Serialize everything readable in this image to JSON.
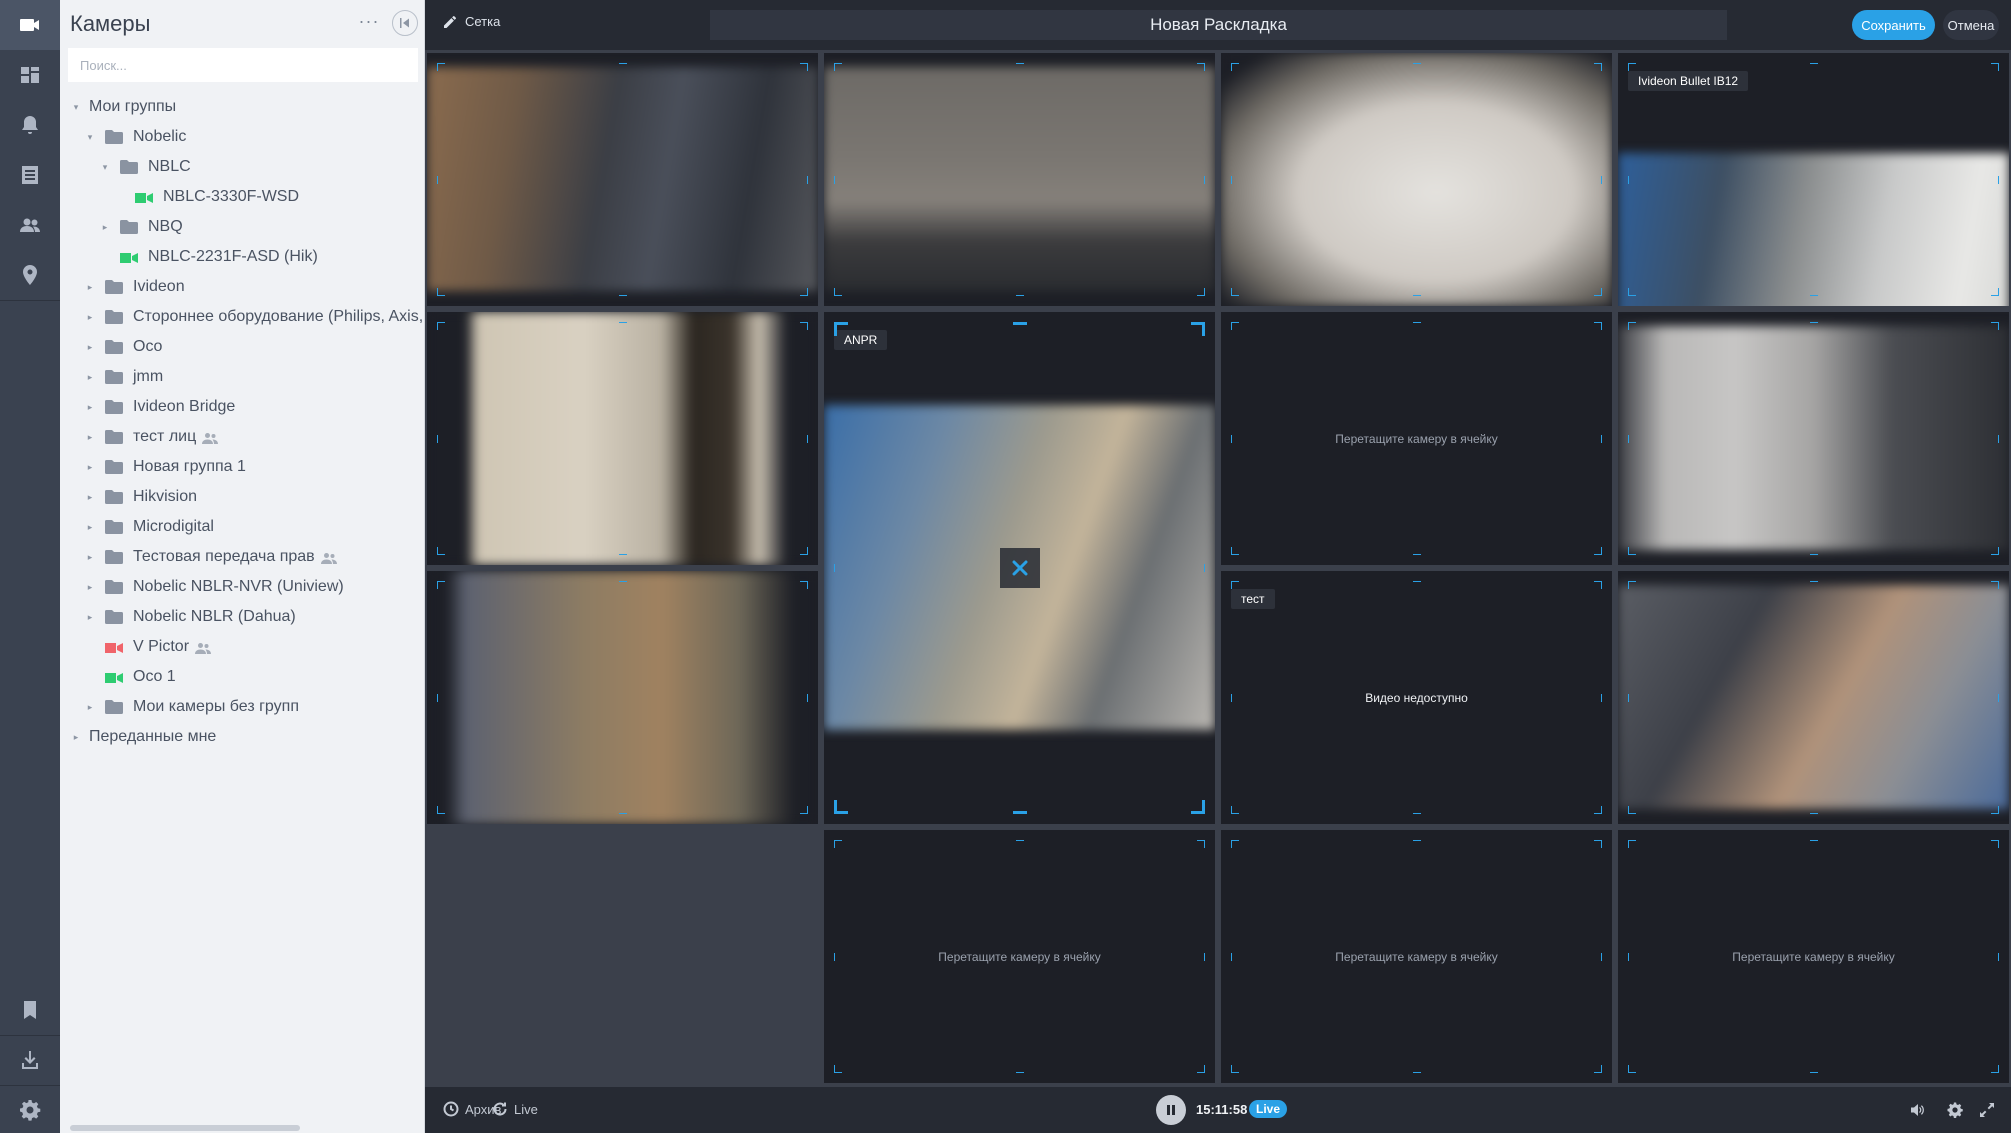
{
  "sidebar": {
    "title": "Камеры",
    "more": "···",
    "search_placeholder": "Поиск...",
    "tree": [
      {
        "label": "Мои группы",
        "level": 0,
        "arrow": "▾",
        "type": "text"
      },
      {
        "label": "Nobelic",
        "level": 1,
        "arrow": "▾",
        "type": "folder"
      },
      {
        "label": "NBLC",
        "level": 2,
        "arrow": "▾",
        "type": "folder"
      },
      {
        "label": "NBLC-3330F-WSD",
        "level": 3,
        "arrow": "",
        "type": "camera",
        "status": "online"
      },
      {
        "label": "NBQ",
        "level": 2,
        "arrow": "▸",
        "type": "folder"
      },
      {
        "label": "NBLC-2231F-ASD (Hik)",
        "level": 2,
        "arrow": "",
        "type": "camera",
        "status": "online"
      },
      {
        "label": "Ivideon",
        "level": 1,
        "arrow": "▸",
        "type": "folder"
      },
      {
        "label": "Стороннее оборудование (Philips, Axis,",
        "level": 1,
        "arrow": "▸",
        "type": "folder"
      },
      {
        "label": "Oco",
        "level": 1,
        "arrow": "▸",
        "type": "folder"
      },
      {
        "label": "jmm",
        "level": 1,
        "arrow": "▸",
        "type": "folder"
      },
      {
        "label": "Ivideon Bridge",
        "level": 1,
        "arrow": "▸",
        "type": "folder"
      },
      {
        "label": "тест лиц",
        "level": 1,
        "arrow": "▸",
        "type": "folder",
        "shared": true
      },
      {
        "label": "Новая группа 1",
        "level": 1,
        "arrow": "▸",
        "type": "folder"
      },
      {
        "label": "Hikvision",
        "level": 1,
        "arrow": "▸",
        "type": "folder"
      },
      {
        "label": "Microdigital",
        "level": 1,
        "arrow": "▸",
        "type": "folder"
      },
      {
        "label": "Тестовая передача прав",
        "level": 1,
        "arrow": "▸",
        "type": "folder",
        "shared": true
      },
      {
        "label": "Nobelic NBLR-NVR (Uniview)",
        "level": 1,
        "arrow": "▸",
        "type": "folder"
      },
      {
        "label": "Nobelic NBLR (Dahua)",
        "level": 1,
        "arrow": "▸",
        "type": "folder"
      },
      {
        "label": "V Pictor",
        "level": 1,
        "arrow": "",
        "type": "camera",
        "status": "offline",
        "shared": true
      },
      {
        "label": "Oco 1",
        "level": 1,
        "arrow": "",
        "type": "camera",
        "status": "online"
      },
      {
        "label": "Мои камеры без групп",
        "level": 1,
        "arrow": "▸",
        "type": "folder"
      },
      {
        "label": "Переданные мне",
        "level": 0,
        "arrow": "▸",
        "type": "text"
      }
    ]
  },
  "topbar": {
    "grid_label": "Сетка",
    "layout_name": "Новая Раскладка",
    "save_label": "Сохранить",
    "cancel_label": "Отмена"
  },
  "cells": [
    {
      "type": "video",
      "palette": "office-warm"
    },
    {
      "type": "video",
      "palette": "office-ceiling"
    },
    {
      "type": "video",
      "palette": "fisheye"
    },
    {
      "type": "video",
      "title": "Ivideon Bullet IB12",
      "palette": "blue-lab"
    },
    {
      "type": "video",
      "palette": "corridor"
    },
    {
      "type": "video",
      "title": "ANPR",
      "palette": "blue-hall",
      "selected": true
    },
    {
      "type": "empty",
      "text": "Перетащите камеру в ячейку"
    },
    {
      "type": "video",
      "palette": "window-room"
    },
    {
      "type": "video",
      "palette": "desks"
    },
    {
      "type": "unavailable",
      "title": "тест",
      "text": "Видео недоступно"
    },
    {
      "type": "video",
      "palette": "workshop"
    },
    {
      "type": "empty",
      "text": "Перетащите камеру в ячейку"
    },
    {
      "type": "empty",
      "text": "Перетащите камеру в ячейку"
    },
    {
      "type": "empty",
      "text": "Перетащите камеру в ячейку"
    }
  ],
  "bottombar": {
    "archive_label": "Архив",
    "live_label": "Live",
    "time": "15:11:58",
    "live_badge": "Live"
  },
  "colors": {
    "accent": "#2aa1e6",
    "online": "#2ecc71",
    "offline": "#f0646a"
  }
}
